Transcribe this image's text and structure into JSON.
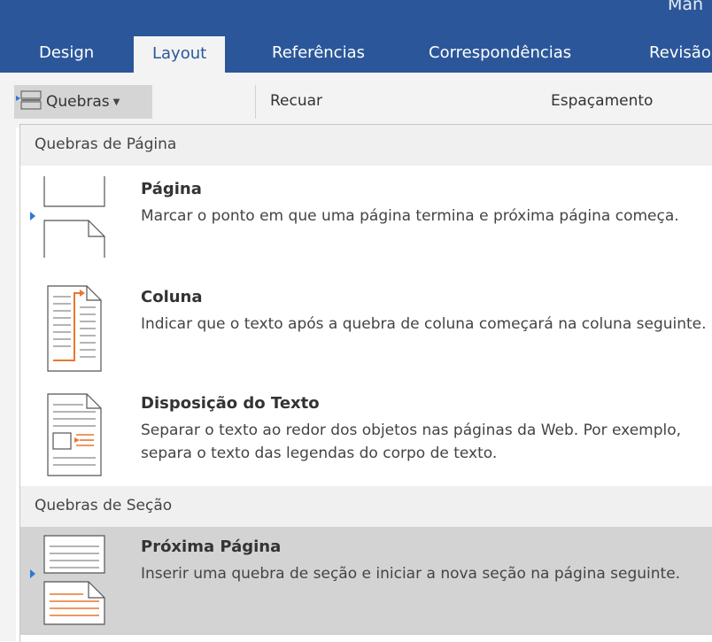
{
  "app": {
    "title_fragment": "Man"
  },
  "tabs": [
    {
      "label": "Design"
    },
    {
      "label": "Layout"
    },
    {
      "label": "Referências"
    },
    {
      "label": "Correspondências"
    },
    {
      "label": "Revisão"
    }
  ],
  "toolbar": {
    "breaks_button": "Quebras",
    "indent_label": "Recuar",
    "spacing_label": "Espaçamento"
  },
  "menu": {
    "page_breaks_header": "Quebras de Página",
    "section_breaks_header": "Quebras de Seção",
    "items": [
      {
        "title": "Página",
        "desc": "Marcar o ponto em que uma página termina e próxima página começa.",
        "icon": "page-break-icon"
      },
      {
        "title": "Coluna",
        "desc": "Indicar que o texto após a quebra de coluna começará na coluna seguinte.",
        "icon": "column-break-icon"
      },
      {
        "title": "Disposição do Texto",
        "desc": "Separar o texto ao redor dos objetos nas páginas da Web. Por exemplo, separa o texto das legendas do corpo de texto.",
        "icon": "text-wrapping-icon"
      },
      {
        "title": "Próxima Página",
        "desc": "Inserir uma quebra de seção e iniciar a nova seção na página seguinte.",
        "icon": "next-page-icon",
        "selected": true
      }
    ]
  },
  "colors": {
    "ribbon": "#2b579a",
    "accent_orange": "#e8772e",
    "selection": "#d3d3d3"
  }
}
